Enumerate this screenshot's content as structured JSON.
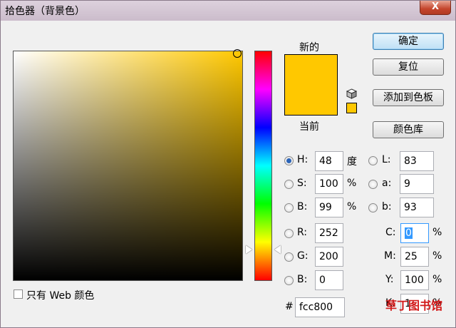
{
  "window": {
    "title": "拾色器（背景色）",
    "close_glyph": "X"
  },
  "preview": {
    "new_label": "新的",
    "current_label": "当前",
    "new_color": "#ffc800",
    "current_color": "#ffc800"
  },
  "buttons": {
    "ok": "确定",
    "reset": "复位",
    "add_to_swatches": "添加到色板",
    "color_libraries": "颜色库"
  },
  "hsb": {
    "h": {
      "label": "H:",
      "value": "48",
      "unit": "度",
      "selected": true
    },
    "s": {
      "label": "S:",
      "value": "100",
      "unit": "%"
    },
    "b": {
      "label": "B:",
      "value": "99",
      "unit": "%"
    }
  },
  "rgb": {
    "r": {
      "label": "R:",
      "value": "252"
    },
    "g": {
      "label": "G:",
      "value": "200"
    },
    "b": {
      "label": "B:",
      "value": "0"
    }
  },
  "lab": {
    "l": {
      "label": "L:",
      "value": "83"
    },
    "a": {
      "label": "a:",
      "value": "9"
    },
    "b": {
      "label": "b:",
      "value": "93"
    }
  },
  "cmyk": {
    "c": {
      "label": "C:",
      "value": "0",
      "unit": "%"
    },
    "m": {
      "label": "M:",
      "value": "25",
      "unit": "%"
    },
    "y": {
      "label": "Y:",
      "value": "100",
      "unit": "%"
    },
    "k": {
      "label": "K:",
      "value": "1",
      "unit": "%"
    }
  },
  "hex": {
    "label": "#",
    "value": "fcc800"
  },
  "web_only": {
    "label": "只有 Web 颜色",
    "checked": false
  },
  "watermark": "草丁图书馆",
  "icons": {
    "close": "close-icon",
    "cube": "web-safe-cube-icon",
    "warning_swatch": "gamut-swatch-icon"
  }
}
